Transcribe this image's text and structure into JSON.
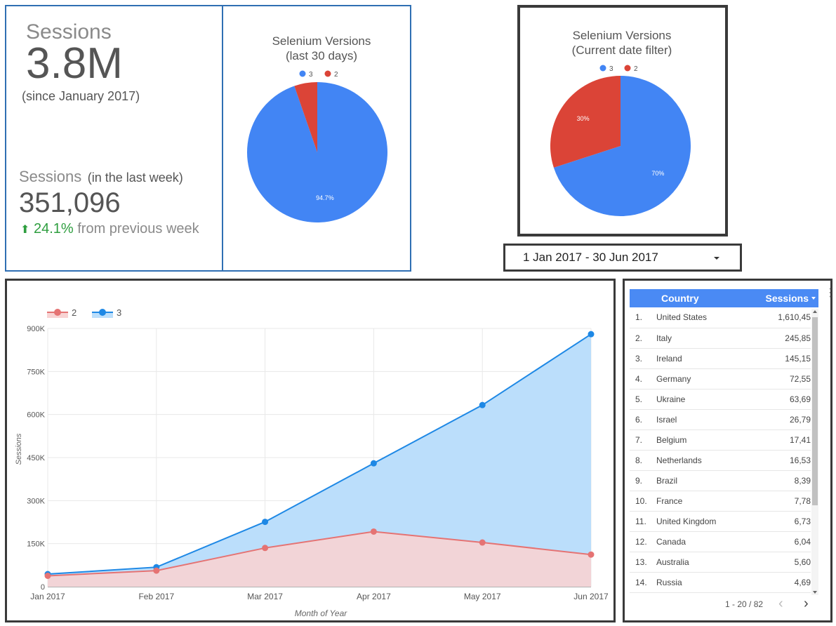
{
  "scorecard": {
    "total_label": "Sessions",
    "total_value": "3.8M",
    "total_note": "(since January 2017)",
    "week_label": "Sessions",
    "week_note": "(in the last week)",
    "week_value": "351,096",
    "change_value": "24.1%",
    "change_text": "from previous week",
    "up_color": "#2e9e3f"
  },
  "date_range": {
    "label": "1 Jan 2017 - 30 Jun 2017"
  },
  "table": {
    "headers": [
      "Country",
      "Sessions"
    ],
    "sort_icon": "sort-desc-icon",
    "rows": [
      {
        "rank": "1.",
        "country": "United States",
        "sessions": "1,610,45"
      },
      {
        "rank": "2.",
        "country": "Italy",
        "sessions": "245,85"
      },
      {
        "rank": "3.",
        "country": "Ireland",
        "sessions": "145,15"
      },
      {
        "rank": "4.",
        "country": "Germany",
        "sessions": "72,55"
      },
      {
        "rank": "5.",
        "country": "Ukraine",
        "sessions": "63,69"
      },
      {
        "rank": "6.",
        "country": "Israel",
        "sessions": "26,79"
      },
      {
        "rank": "7.",
        "country": "Belgium",
        "sessions": "17,41"
      },
      {
        "rank": "8.",
        "country": "Netherlands",
        "sessions": "16,53"
      },
      {
        "rank": "9.",
        "country": "Brazil",
        "sessions": "8,39"
      },
      {
        "rank": "10.",
        "country": "France",
        "sessions": "7,78"
      },
      {
        "rank": "11.",
        "country": "United Kingdom",
        "sessions": "6,73"
      },
      {
        "rank": "12.",
        "country": "Canada",
        "sessions": "6,04"
      },
      {
        "rank": "13.",
        "country": "Australia",
        "sessions": "5,60"
      },
      {
        "rank": "14.",
        "country": "Russia",
        "sessions": "4,69"
      }
    ],
    "pagination": "1 - 20 / 82",
    "header_color": "#4a8af4"
  },
  "colors": {
    "v3": "#4285f4",
    "v2": "#db4437",
    "line3": "#1e88e5",
    "line2": "#e57373",
    "area3": "#bbdefb",
    "area2": "#f8d3d3"
  },
  "chart_data": [
    {
      "type": "pie",
      "title": [
        "Selenium Versions",
        "(last 30 days)"
      ],
      "labels": [
        "3",
        "2"
      ],
      "values": [
        94.7,
        5.3
      ],
      "data_labels": [
        "94.7%",
        ""
      ],
      "legend": "top"
    },
    {
      "type": "pie",
      "title": [
        "Selenium Versions",
        "(Current date filter)"
      ],
      "labels": [
        "3",
        "2"
      ],
      "values": [
        70,
        30
      ],
      "data_labels": [
        "70%",
        "30%"
      ],
      "legend": "top"
    },
    {
      "type": "area",
      "categories": [
        "Jan 2017",
        "Feb 2017",
        "Mar 2017",
        "Apr 2017",
        "May 2017",
        "Jun 2017"
      ],
      "series": [
        {
          "name": "2",
          "values": [
            38000,
            56000,
            135000,
            192000,
            154000,
            112000
          ]
        },
        {
          "name": "3",
          "values": [
            44000,
            68000,
            226000,
            430000,
            633000,
            880000
          ]
        }
      ],
      "xlabel": "Month of Year",
      "ylabel": "Sessions",
      "ylim": [
        0,
        900000
      ],
      "yticks": [
        "0",
        "150K",
        "300K",
        "450K",
        "600K",
        "750K",
        "900K"
      ],
      "grid": true,
      "legend": "top-left"
    }
  ]
}
